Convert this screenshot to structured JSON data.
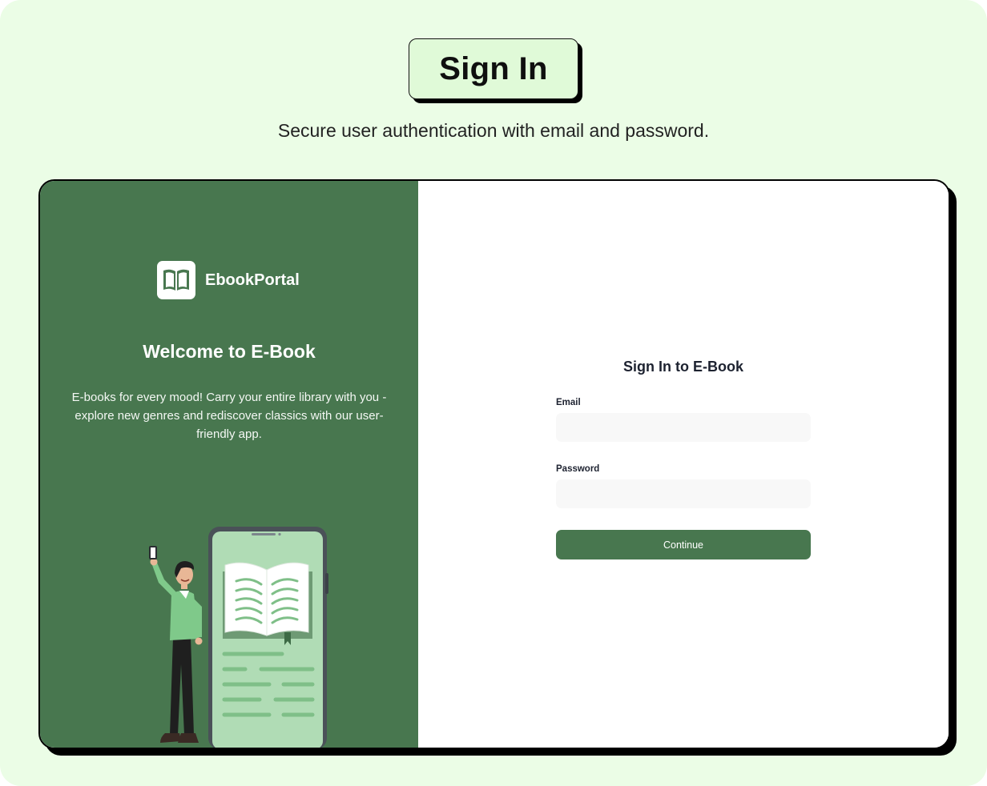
{
  "header": {
    "title": "Sign In",
    "subtitle": "Secure user authentication with email and password."
  },
  "brand": {
    "name": "EbookPortal",
    "icon": "open-book-icon",
    "color": "#48774f"
  },
  "left_panel": {
    "welcome": "Welcome to E-Book",
    "description": "E-books for every mood! Carry your entire library with you - explore new genres and rediscover classics with our user-friendly app."
  },
  "form": {
    "title": "Sign In to E-Book",
    "email_label": "Email",
    "email_value": "",
    "email_placeholder": "",
    "password_label": "Password",
    "password_value": "",
    "password_placeholder": "",
    "submit_label": "Continue"
  },
  "colors": {
    "background": "#ebfde6",
    "panel_green": "#48774f",
    "title_badge": "#e0fad8"
  }
}
